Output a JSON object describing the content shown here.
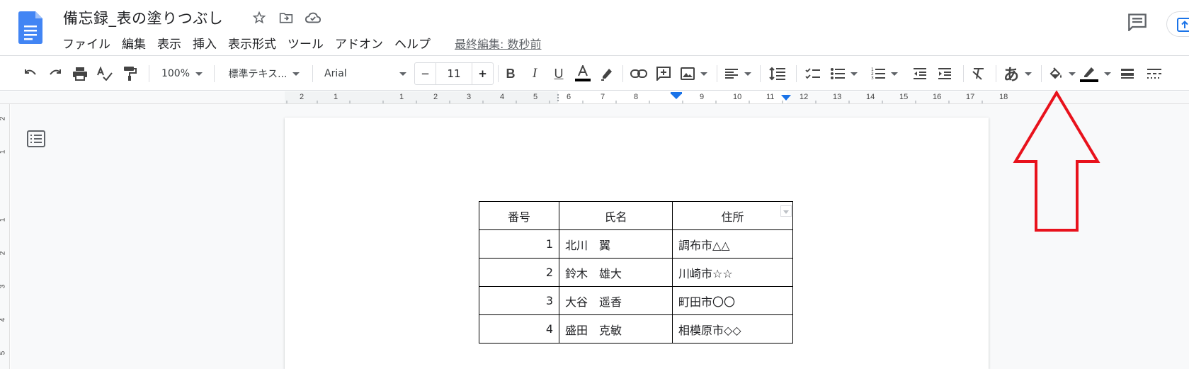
{
  "header": {
    "title": "備忘録_表の塗りつぶし",
    "menu": [
      "ファイル",
      "編集",
      "表示",
      "挿入",
      "表示形式",
      "ツール",
      "アドオン",
      "ヘルプ"
    ],
    "last_edit": "最終編集: 数秒前"
  },
  "toolbar": {
    "zoom": "100%",
    "style": "標準テキス...",
    "font": "Arial",
    "font_size": "11",
    "minus": "−",
    "plus": "+",
    "input_mode": "あ"
  },
  "ruler": {
    "horizontal": [
      "2",
      "1",
      "1",
      "2",
      "3",
      "4",
      "5",
      "6",
      "7",
      "8",
      "9",
      "10",
      "11",
      "12",
      "13",
      "14",
      "15",
      "16",
      "17",
      "18"
    ],
    "vertical": [
      "2",
      "1",
      "1",
      "2",
      "3",
      "4",
      "5"
    ]
  },
  "table": {
    "headers": [
      "番号",
      "氏名",
      "住所"
    ],
    "rows": [
      [
        "1",
        "北川　翼",
        "調布市△△"
      ],
      [
        "2",
        "鈴木　雄大",
        "川崎市☆☆"
      ],
      [
        "3",
        "大谷　遥香",
        "町田市〇〇"
      ],
      [
        "4",
        "盛田　克敏",
        "相模原市◇◇"
      ]
    ]
  },
  "colors": {
    "docs_blue": "#4285f4",
    "annotation_red": "#e8121c"
  }
}
